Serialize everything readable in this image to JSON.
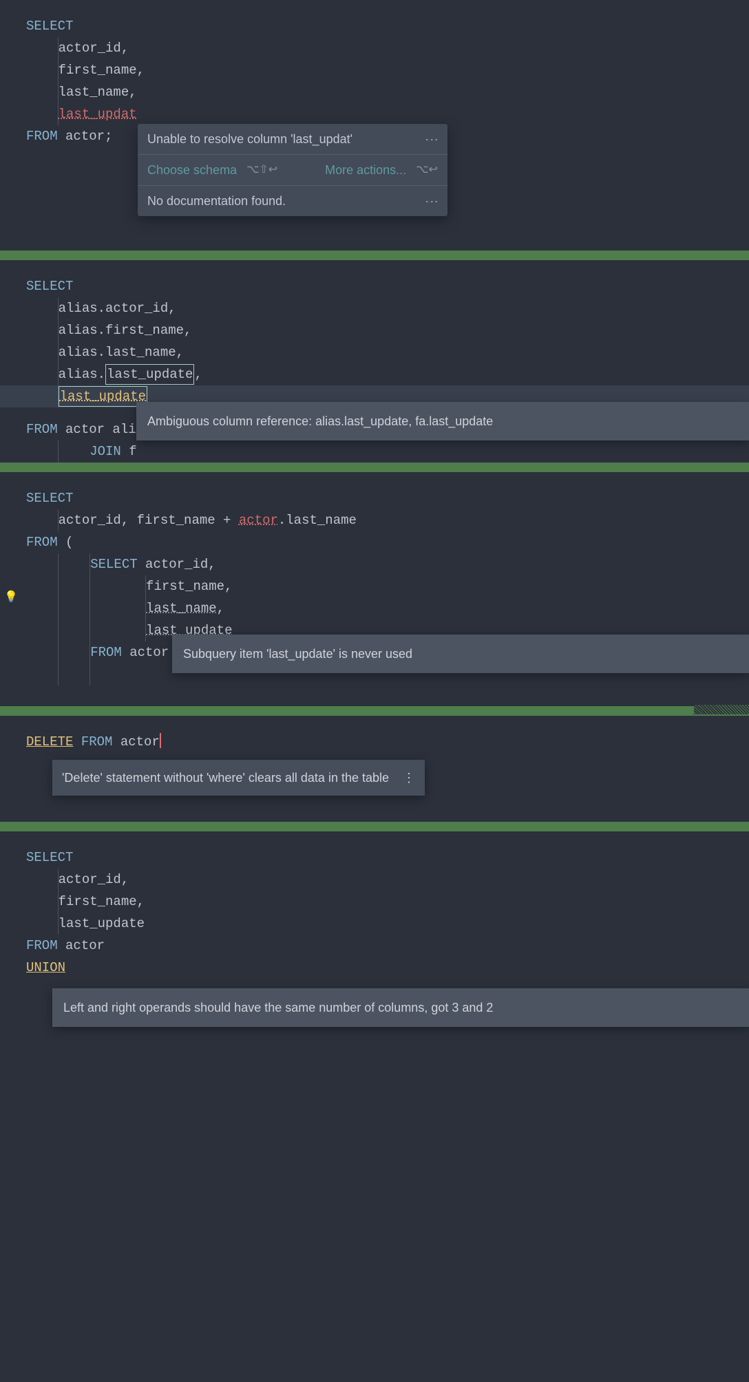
{
  "block1": {
    "kw_select": "SELECT",
    "col1": "actor_id,",
    "col2": "first_name,",
    "col3": "last_name,",
    "col4_err": "last_updat",
    "kw_from": "FROM",
    "table": "actor",
    "semicolon": ";",
    "popup": {
      "title": "Unable to resolve column 'last_updat'",
      "choose_schema": "Choose schema",
      "shortcut1": "⌥⇧↩",
      "more_actions": "More actions...",
      "shortcut2": "⌥↩",
      "no_doc": "No documentation found."
    }
  },
  "block2": {
    "kw_select": "SELECT",
    "line1": "alias.actor_id,",
    "line2": "alias.first_name,",
    "line3": "alias.last_name,",
    "line4_prefix": "alias.",
    "line4_box": "last_update",
    "line4_suffix": ",",
    "line5_box": "last_update",
    "kw_from": "FROM",
    "from_text": "actor ali",
    "join_text": "JOIN f",
    "tooltip": "Ambiguous column reference: alias.last_update, fa.last_update"
  },
  "block3": {
    "kw_select": "SELECT",
    "line1a": "actor_id, first_name + ",
    "line1_err": "actor",
    "line1b": ".last_name",
    "kw_from": "FROM",
    "paren": " (",
    "inner_select": "SELECT",
    "inner_col1": " actor_id,",
    "inner_col2": "first_name,",
    "inner_col3": "last_name",
    "inner_col3_suffix": ",",
    "inner_col4": "last_update",
    "inner_from": "FROM",
    "inner_table": " actor",
    "tooltip": "Subquery item 'last_update' is never used"
  },
  "block4": {
    "kw_delete": "DELETE",
    "kw_from": "FROM",
    "table": "actor",
    "tooltip": "'Delete' statement without 'where' clears all data in the table"
  },
  "block5": {
    "kw_select": "SELECT",
    "col1": "actor_id,",
    "col2": "first_name,",
    "col3": "last_update",
    "kw_from": "FROM",
    "table": "actor",
    "kw_union": "UNION",
    "tooltip": "Left and right operands should have the same number of columns, got 3 and 2"
  }
}
